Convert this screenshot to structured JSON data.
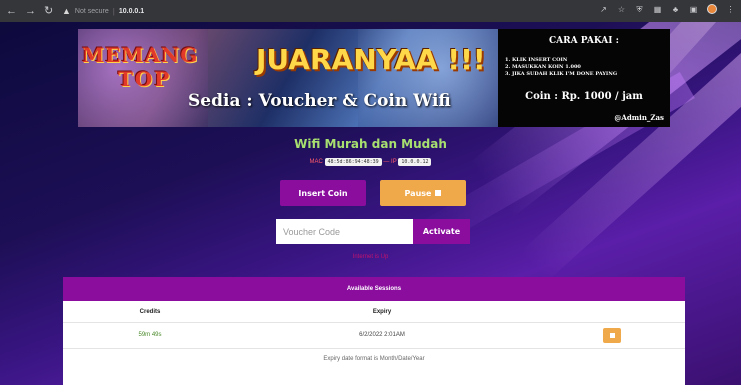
{
  "browser": {
    "nav_icons": [
      "back-arrow",
      "forward-arrow",
      "reload"
    ],
    "security_text": "Not secure",
    "url": "10.0.0.1"
  },
  "banner": {
    "line1": "MEMANG",
    "line2": "TOP",
    "headline": "JUARANYAA !!!",
    "tagline": "Sedia : Voucher & Coin Wifi",
    "info_title": "CARA PAKAI :",
    "steps": [
      "1. KLIK INSERT COIN",
      "2. MASUKKAN KOIN 1.000",
      "3. JIKA SUDAH KLIK I'M DONE PAYING"
    ],
    "price": "Coin : Rp. 1000 / jam",
    "admin": "@Admin_Zas"
  },
  "main": {
    "title": "Wifi Murah dan Mudah",
    "mac_label": "MAC",
    "mac_value": "48:5d:86:94:48:39",
    "ip_label": "IP",
    "ip_value": "10.0.0.12",
    "insert_coin": "Insert Coin",
    "pause": "Pause",
    "voucher_placeholder": "Voucher Code",
    "activate": "Activate",
    "status": "Internet is Up"
  },
  "sessions": {
    "title": "Available Sessions",
    "columns": [
      "Credits",
      "Expiry"
    ],
    "rows": [
      {
        "credits": "59m 49s",
        "expiry": "6/2/2022 2:01AM"
      }
    ],
    "note": "Expiry date format is Month/Date/Year"
  },
  "colors": {
    "accent_purple": "#8a0d9e",
    "accent_orange": "#f0a94a",
    "title_green": "#a8e070",
    "status_pink": "#c0136e"
  }
}
